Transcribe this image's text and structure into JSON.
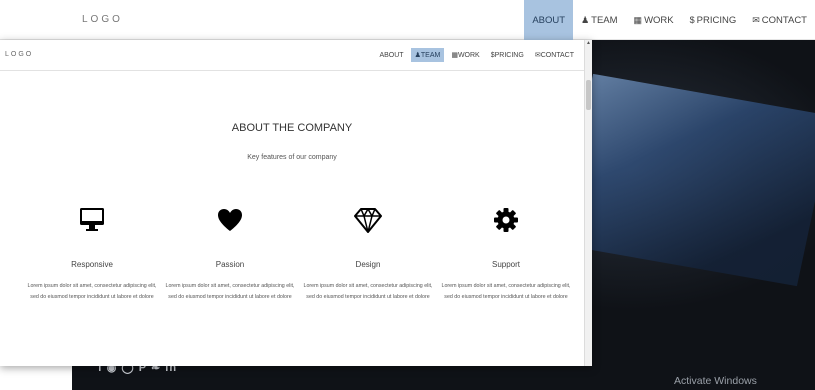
{
  "background_site": {
    "logo": "LOGO",
    "menu": [
      {
        "label": "ABOUT",
        "icon": "",
        "active": true
      },
      {
        "label": "TEAM",
        "icon": "user-icon",
        "active": false
      },
      {
        "label": "WORK",
        "icon": "grid-icon",
        "active": false
      },
      {
        "label": "PRICING",
        "icon": "dollar-icon",
        "active": false
      },
      {
        "label": "CONTACT",
        "icon": "envelope-icon",
        "active": false
      }
    ],
    "social_icons": [
      "facebook-icon",
      "instagram-icon",
      "github-icon",
      "pinterest-icon",
      "twitter-icon",
      "linkedin-icon"
    ],
    "watermark": "Activate Windows"
  },
  "window": {
    "logo": "LOGO",
    "menu": [
      {
        "label": "ABOUT",
        "icon": "",
        "active": false
      },
      {
        "label": "TEAM",
        "icon": "user-icon",
        "active": true
      },
      {
        "label": "WORK",
        "icon": "grid-icon",
        "active": false
      },
      {
        "label": "PRICING",
        "icon": "dollar-icon",
        "active": false
      },
      {
        "label": "CONTACT",
        "icon": "envelope-icon",
        "active": false
      }
    ],
    "section": {
      "title": "ABOUT THE COMPANY",
      "subtitle": "Key features of our company"
    },
    "features": [
      {
        "name": "Responsive",
        "icon": "desktop-icon",
        "desc": "Lorem ipsum dolor sit amet, consectetur adipiscing elit, sed do eiusmod tempor incididunt ut labore et dolore"
      },
      {
        "name": "Passion",
        "icon": "heart-icon",
        "desc": "Lorem ipsum dolor sit amet, consectetur adipiscing elit, sed do eiusmod tempor incididunt ut labore et dolore"
      },
      {
        "name": "Design",
        "icon": "diamond-icon",
        "desc": "Lorem ipsum dolor sit amet, consectetur adipiscing elit, sed do eiusmod tempor incididunt ut labore et dolore"
      },
      {
        "name": "Support",
        "icon": "gear-icon",
        "desc": "Lorem ipsum dolor sit amet, consectetur adipiscing elit, sed do eiusmod tempor incididunt ut labore et dolore"
      }
    ]
  },
  "colors": {
    "active_menu_bg": "#a8c3e0",
    "hero_dark": "#1b2028"
  }
}
